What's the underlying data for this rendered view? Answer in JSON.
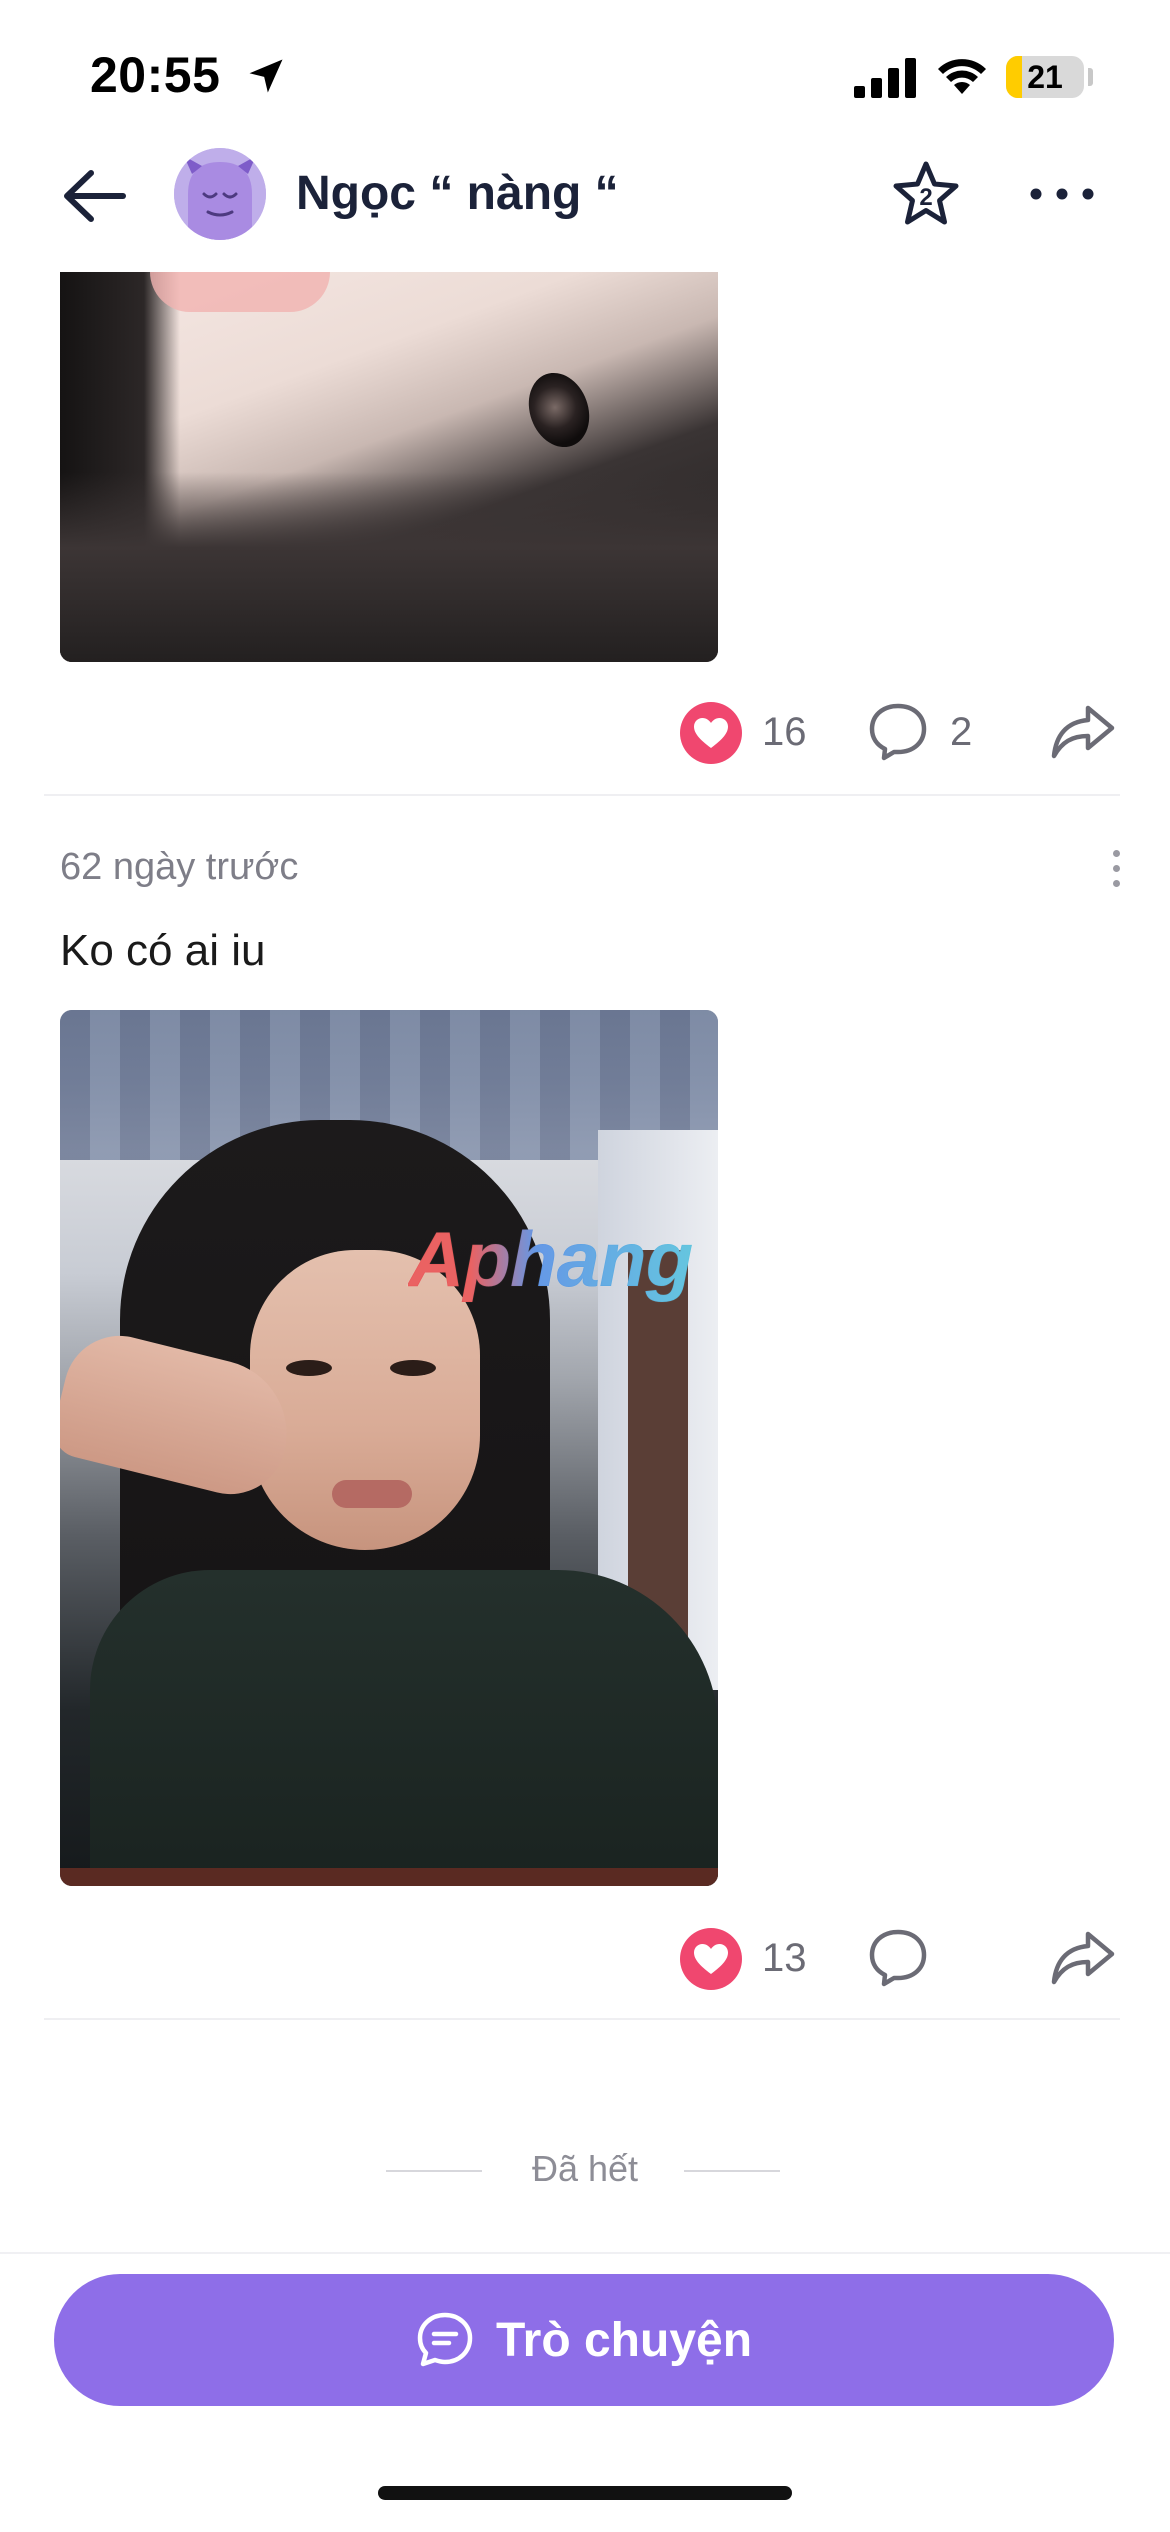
{
  "status_bar": {
    "time": "20:55",
    "battery_level": "21",
    "battery_fraction": 0.21,
    "icons": [
      "location-arrow-icon",
      "cellular-signal-icon",
      "wifi-icon",
      "battery-icon"
    ]
  },
  "header": {
    "profile_name": "Ngọc “ nàng “",
    "star_badge": "2",
    "icons": [
      "back-arrow-icon",
      "star-icon",
      "more-horizontal-icon"
    ]
  },
  "feed": {
    "posts": [
      {
        "likes": "16",
        "comments": "2"
      },
      {
        "time": "62 ngày trước",
        "text": "Ko có ai iu",
        "watermark": "Aphang",
        "likes": "13",
        "comments": ""
      }
    ],
    "end_label": "Đã hết"
  },
  "bottom": {
    "chat_label": "Trò chuyện"
  },
  "colors": {
    "accent": "#8e6ee8",
    "like": "#f0476f",
    "title": "#1b2239",
    "muted": "#7e7e88"
  }
}
